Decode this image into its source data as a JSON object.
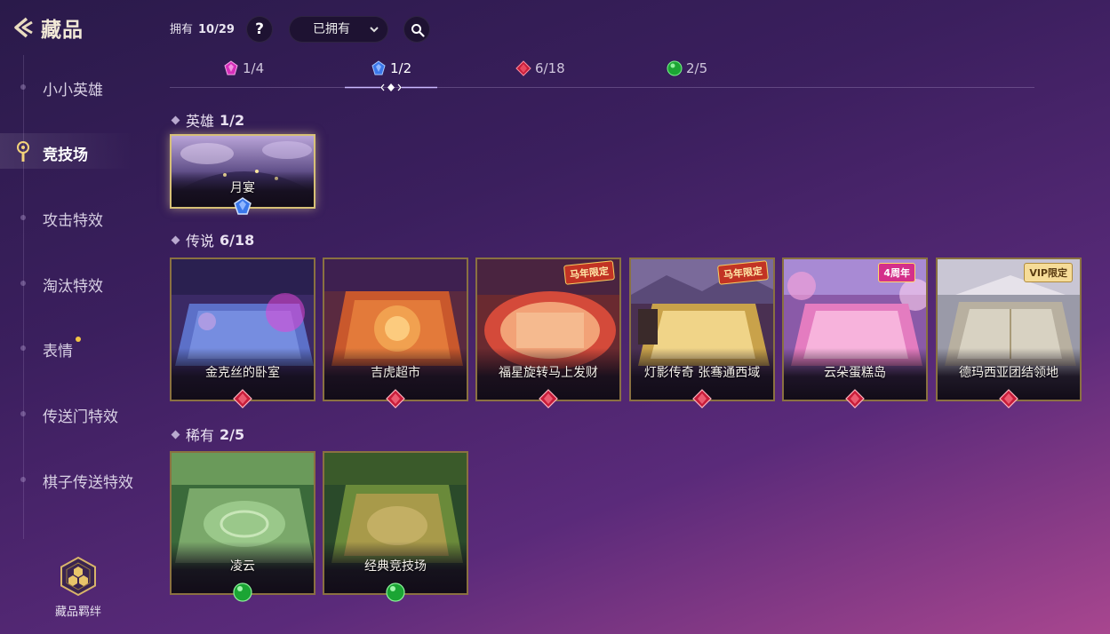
{
  "header": {
    "title": "藏品"
  },
  "sidebar": {
    "items": [
      {
        "label": "小小英雄"
      },
      {
        "label": "竞技场"
      },
      {
        "label": "攻击特效"
      },
      {
        "label": "淘汰特效"
      },
      {
        "label": "表情"
      },
      {
        "label": "传送门特效"
      },
      {
        "label": "棋子传送特效"
      }
    ],
    "bond_label": "藏品羁绊"
  },
  "topbar": {
    "owned_label": "拥有",
    "owned_count": "10/29",
    "help": "?",
    "filter_value": "已拥有"
  },
  "rarity_tabs": [
    {
      "count": "1/4",
      "gem": "purple-gem-icon",
      "color": "#d52fb9"
    },
    {
      "count": "1/2",
      "gem": "blue-gem-icon",
      "color": "#3b78ea",
      "active": true
    },
    {
      "count": "6/18",
      "gem": "red-gem-icon",
      "color": "#c81d3a"
    },
    {
      "count": "2/5",
      "gem": "green-gem-icon",
      "color": "#1ba534"
    }
  ],
  "sections": {
    "hero": {
      "title": "英雄",
      "count": "1/2",
      "cards": [
        {
          "name": "月宴"
        }
      ]
    },
    "legend": {
      "title": "传说",
      "count": "6/18",
      "cards": [
        {
          "name": "金克丝的卧室"
        },
        {
          "name": "吉虎超市"
        },
        {
          "name": "福星旋转马上发财",
          "tag": "马年限定"
        },
        {
          "name": "灯影传奇  张骞通西域",
          "tag": "马年限定"
        },
        {
          "name": "云朵蛋糕岛",
          "tag": "4周年"
        },
        {
          "name": "德玛西亚团结领地",
          "tag": "VIP限定"
        }
      ]
    },
    "rare": {
      "title": "稀有",
      "count": "2/5",
      "cards": [
        {
          "name": "凌云"
        },
        {
          "name": "经典竞技场"
        }
      ]
    }
  },
  "colors": {
    "card_border": "#8a7141",
    "hero_border": "#d7c077",
    "accent_gold": "#f3c445"
  }
}
